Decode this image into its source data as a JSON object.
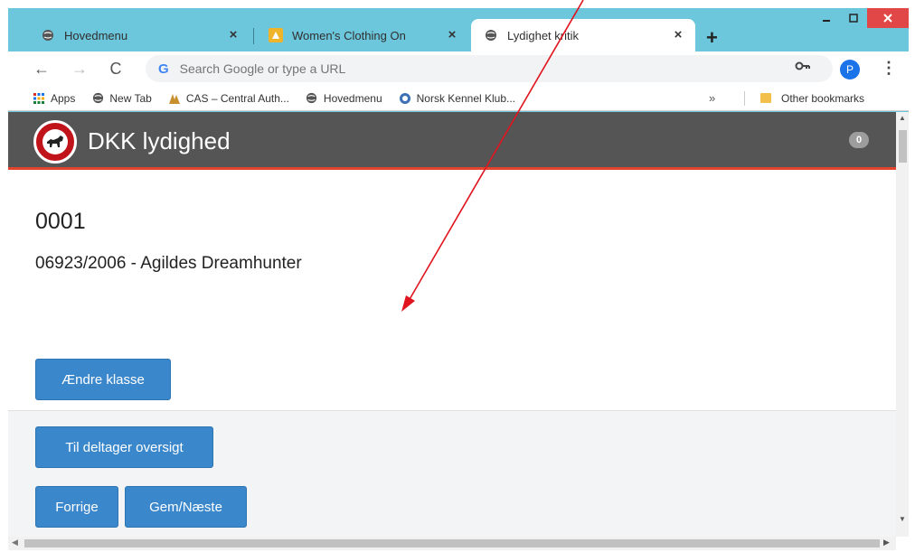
{
  "browser": {
    "tabs": [
      {
        "title": "Hovedmenu",
        "icon": "globe-icon",
        "active": false
      },
      {
        "title": "Women's Clothing On",
        "icon": "amazon-icon",
        "active": false
      },
      {
        "title": "Lydighet kritik",
        "icon": "globe-icon",
        "active": true
      }
    ],
    "close_glyph": "×",
    "new_tab_glyph": "+",
    "omnibox_placeholder": "Search Google or type a URL",
    "profile_initial": "P",
    "bookmarks": [
      {
        "label": "Apps",
        "icon": "apps-grid-icon"
      },
      {
        "label": "New Tab",
        "icon": "globe-icon"
      },
      {
        "label": "CAS – Central Auth...",
        "icon": "cas-icon"
      },
      {
        "label": "Hovedmenu",
        "icon": "globe-icon"
      },
      {
        "label": "Norsk Kennel Klub...",
        "icon": "nkk-icon"
      }
    ],
    "bookmarks_overflow": "»",
    "other_bookmarks": "Other bookmarks"
  },
  "app": {
    "title": "DKK lydighed",
    "badge_count": "0"
  },
  "participant": {
    "number": "0001",
    "dog": "06923/2006 - Agildes Dreamhunter"
  },
  "buttons": {
    "change_class": "Ændre klasse",
    "overview": "Til deltager oversigt",
    "previous": "Forrige",
    "save_next": "Gem/Næste"
  },
  "colors": {
    "chrome_accent": "#6cc6dc",
    "header_bg": "#555555",
    "header_stripe": "#e4432d",
    "button_blue": "#3a87cc",
    "annotation_arrow": "#e0141e"
  }
}
